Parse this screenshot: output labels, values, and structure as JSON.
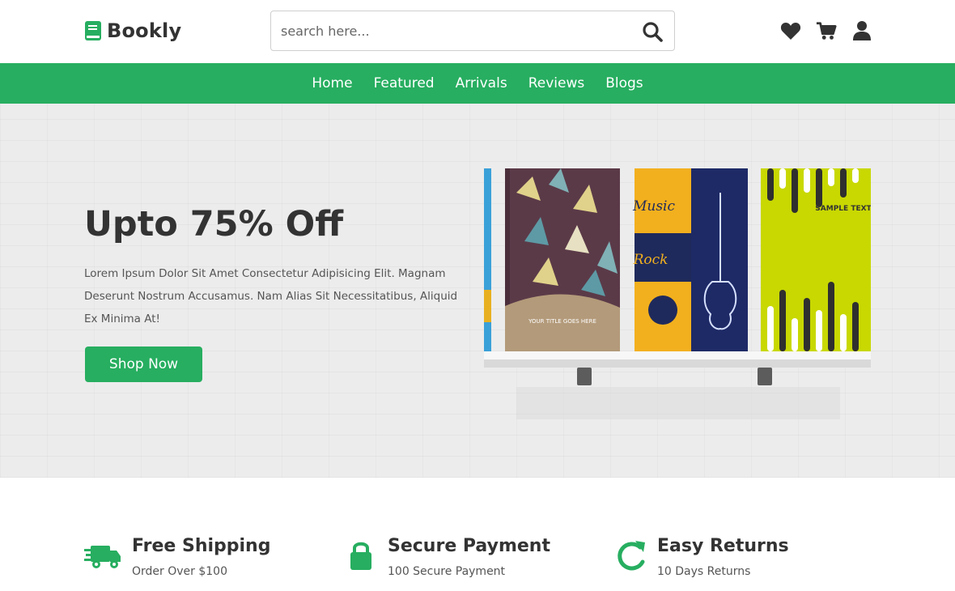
{
  "header": {
    "logo_text": "Bookly",
    "search": {
      "placeholder": "search here..."
    },
    "icons": [
      "heart-icon",
      "cart-icon",
      "user-icon"
    ]
  },
  "nav": {
    "items": [
      "Home",
      "Featured",
      "Arrivals",
      "Reviews",
      "Blogs"
    ]
  },
  "hero": {
    "title": "Upto 75% Off",
    "description": "Lorem Ipsum Dolor Sit Amet Consectetur Adipisicing Elit. Magnam Deserunt Nostrum Accusamus. Nam Alias Sit Necessitatibus, Aliquid Ex Minima At!",
    "button_label": "Shop Now",
    "book_texts": {
      "book1": "YOUR TITLE GOES HERE",
      "book2a": "Music",
      "book2b": "Rock",
      "book3": "SAMPLE TEXT"
    }
  },
  "features": [
    {
      "icon": "truck-icon",
      "title": "Free Shipping",
      "subtitle": "Order Over $100"
    },
    {
      "icon": "lock-icon",
      "title": "Secure Payment",
      "subtitle": "100 Secure Payment"
    },
    {
      "icon": "redo-icon",
      "title": "Easy Returns",
      "subtitle": "10 Days Returns"
    }
  ],
  "colors": {
    "accent": "#27ae60",
    "text_dark": "#333333",
    "hero_bg": "#ececec"
  }
}
